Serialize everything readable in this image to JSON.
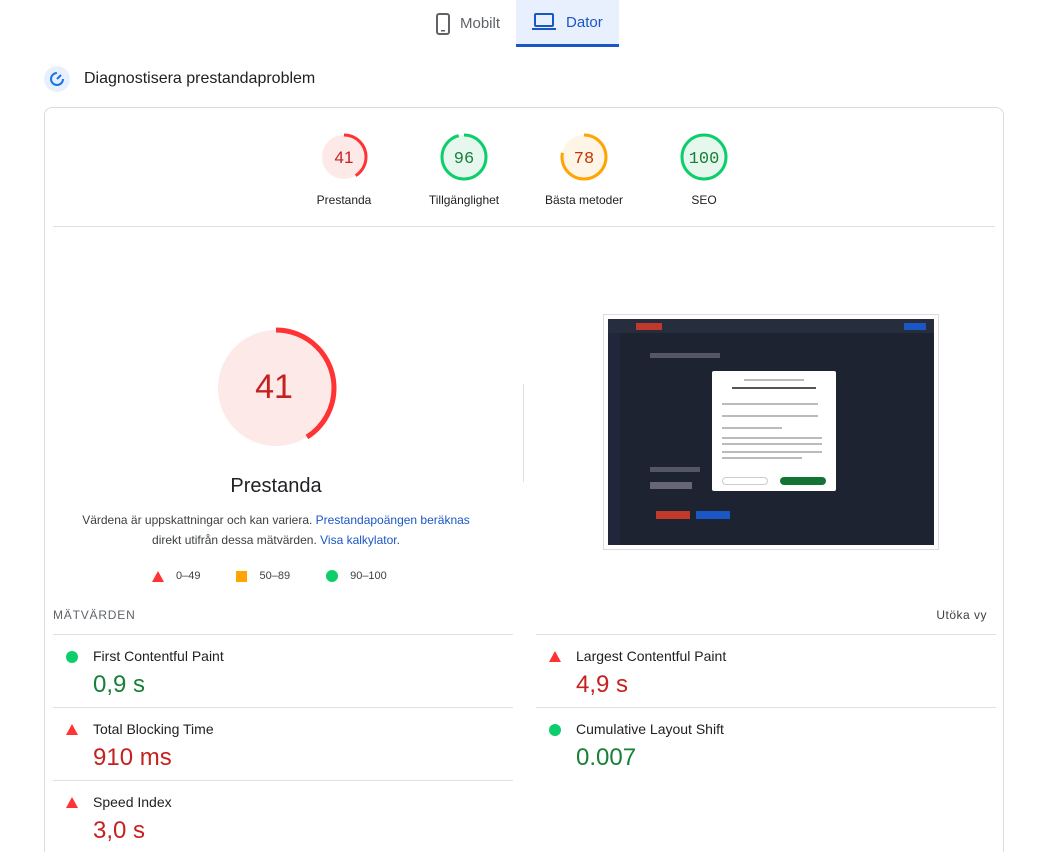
{
  "tabs": [
    {
      "label": "Mobilt",
      "icon": "smartphone-icon",
      "active": false
    },
    {
      "label": "Dator",
      "icon": "laptop-icon",
      "active": true
    }
  ],
  "section": {
    "title": "Diagnostisera prestandaproblem",
    "icon": "speed-gauge-icon"
  },
  "categories": [
    {
      "score": "41",
      "label": "Prestanda",
      "status": "fail"
    },
    {
      "score": "96",
      "label": "Tillgänglighet",
      "status": "pass"
    },
    {
      "score": "78",
      "label": "Bästa metoder",
      "status": "average"
    },
    {
      "score": "100",
      "label": "SEO",
      "status": "pass"
    }
  ],
  "main_score": {
    "value": "41",
    "title": "Prestanda"
  },
  "note": {
    "text_before": "Värdena är uppskattningar och kan variera. ",
    "link1": "Prestandapoängen beräknas",
    "text_middle": " direkt utifrån dessa mätvärden. ",
    "link2": "Visa kalkylator",
    "text_after": "."
  },
  "legend": [
    {
      "range": "0–49",
      "icon": "triangle-icon",
      "color": "#ff3333"
    },
    {
      "range": "50–89",
      "icon": "square-icon",
      "color": "#ffa400"
    },
    {
      "range": "90–100",
      "icon": "circle-icon",
      "color": "#0cce6b"
    }
  ],
  "metrics_header": "MÄTVÄRDEN",
  "expand_label": "Utöka vy",
  "metrics": [
    {
      "name": "First Contentful Paint",
      "value": "0,9 s",
      "status": "pass"
    },
    {
      "name": "Largest Contentful Paint",
      "value": "4,9 s",
      "status": "fail"
    },
    {
      "name": "Total Blocking Time",
      "value": "910 ms",
      "status": "fail"
    },
    {
      "name": "Cumulative Layout Shift",
      "value": "0.007",
      "status": "pass"
    },
    {
      "name": "Speed Index",
      "value": "3,0 s",
      "status": "fail"
    }
  ],
  "colors": {
    "fail": "#ff3333",
    "average": "#ffa400",
    "pass": "#0cce6b",
    "accent": "#1a56c4"
  }
}
